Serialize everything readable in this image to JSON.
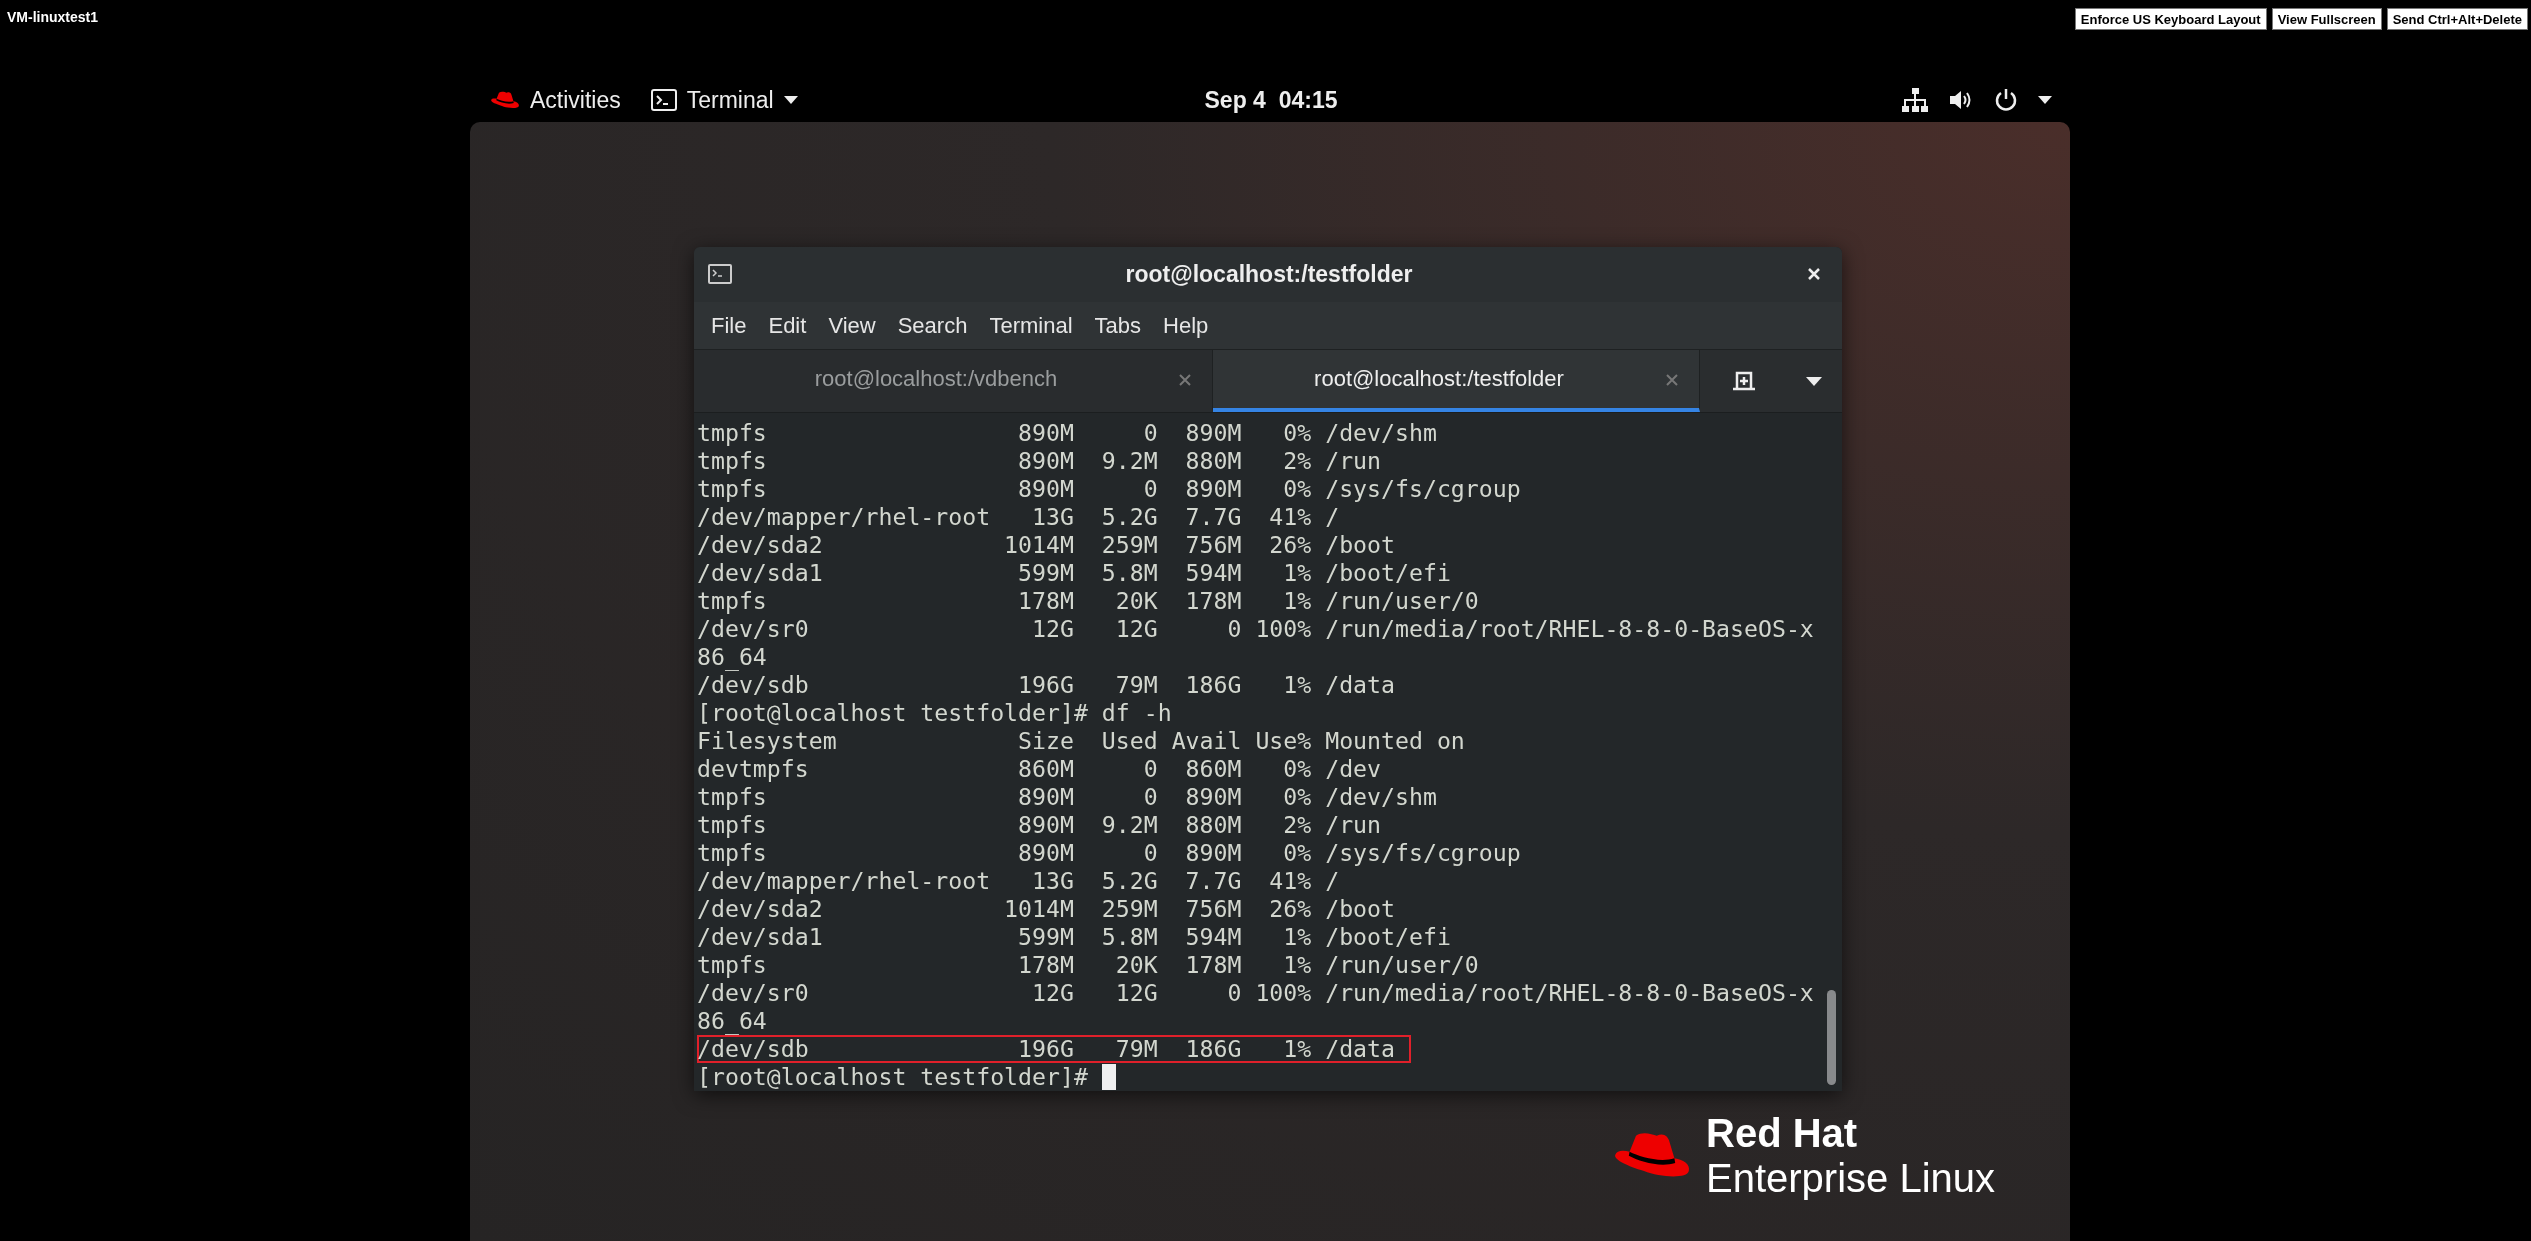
{
  "vm_toolbar": {
    "title": "VM-linuxtest1",
    "buttons": [
      "Enforce US Keyboard Layout",
      "View Fullscreen",
      "Send Ctrl+Alt+Delete"
    ]
  },
  "top_bar": {
    "activities": "Activities",
    "app_menu": "Terminal",
    "clock": "Sep 4  04:15"
  },
  "terminal": {
    "title": "root@localhost:/testfolder",
    "menu": [
      "File",
      "Edit",
      "View",
      "Search",
      "Terminal",
      "Tabs",
      "Help"
    ],
    "tabs": [
      {
        "label": "root@localhost:/vdbench",
        "selected": false
      },
      {
        "label": "root@localhost:/testfolder",
        "selected": true
      }
    ],
    "lines": [
      {
        "text": "tmpfs                  890M     0  890M   0% /dev/shm",
        "highlighted": false
      },
      {
        "text": "tmpfs                  890M  9.2M  880M   2% /run",
        "highlighted": false
      },
      {
        "text": "tmpfs                  890M     0  890M   0% /sys/fs/cgroup",
        "highlighted": false
      },
      {
        "text": "/dev/mapper/rhel-root   13G  5.2G  7.7G  41% /",
        "highlighted": false
      },
      {
        "text": "/dev/sda2             1014M  259M  756M  26% /boot",
        "highlighted": false
      },
      {
        "text": "/dev/sda1              599M  5.8M  594M   1% /boot/efi",
        "highlighted": false
      },
      {
        "text": "tmpfs                  178M   20K  178M   1% /run/user/0",
        "highlighted": false
      },
      {
        "text": "/dev/sr0                12G   12G     0 100% /run/media/root/RHEL-8-8-0-BaseOS-x",
        "highlighted": false
      },
      {
        "text": "86_64",
        "highlighted": false
      },
      {
        "text": "/dev/sdb               196G   79M  186G   1% /data",
        "highlighted": false
      },
      {
        "text": "[root@localhost testfolder]# df -h",
        "highlighted": false
      },
      {
        "text": "Filesystem             Size  Used Avail Use% Mounted on",
        "highlighted": false
      },
      {
        "text": "devtmpfs               860M     0  860M   0% /dev",
        "highlighted": false
      },
      {
        "text": "tmpfs                  890M     0  890M   0% /dev/shm",
        "highlighted": false
      },
      {
        "text": "tmpfs                  890M  9.2M  880M   2% /run",
        "highlighted": false
      },
      {
        "text": "tmpfs                  890M     0  890M   0% /sys/fs/cgroup",
        "highlighted": false
      },
      {
        "text": "/dev/mapper/rhel-root   13G  5.2G  7.7G  41% /",
        "highlighted": false
      },
      {
        "text": "/dev/sda2             1014M  259M  756M  26% /boot",
        "highlighted": false
      },
      {
        "text": "/dev/sda1              599M  5.8M  594M   1% /boot/efi",
        "highlighted": false
      },
      {
        "text": "tmpfs                  178M   20K  178M   1% /run/user/0",
        "highlighted": false
      },
      {
        "text": "/dev/sr0                12G   12G     0 100% /run/media/root/RHEL-8-8-0-BaseOS-x",
        "highlighted": false
      },
      {
        "text": "86_64",
        "highlighted": false
      },
      {
        "text": "/dev/sdb               196G   79M  186G   1% /data",
        "highlighted": true
      }
    ],
    "prompt": {
      "text": "[root@localhost testfolder]#",
      "cursor": true
    }
  },
  "logo": {
    "brand": "Red Hat",
    "product": "Enterprise Linux"
  }
}
